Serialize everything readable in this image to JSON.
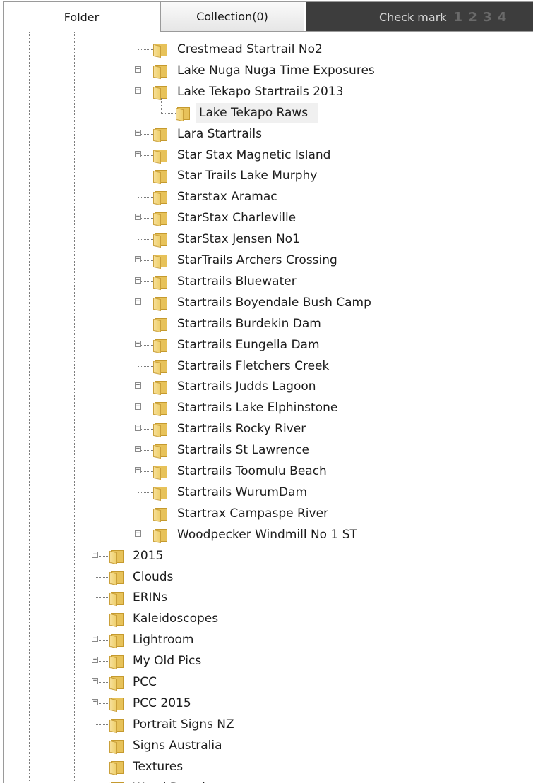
{
  "tabs": {
    "folder": "Folder",
    "collection": "Collection(0)",
    "check_mark": "Check mark",
    "check_digits": "1 2 3 4"
  },
  "tree": {
    "level3_items": [
      {
        "label": "Crestmead Startrail No2",
        "expandable": false
      },
      {
        "label": "Lake Nuga Nuga Time Exposures",
        "expandable": true
      },
      {
        "label": "Lake Tekapo Startrails 2013",
        "expandable": true,
        "expanded": true
      },
      {
        "label": "Lake Tekapo Raws",
        "expandable": false,
        "child": true,
        "selected": true
      },
      {
        "label": "Lara Startrails",
        "expandable": true
      },
      {
        "label": "Star Stax Magnetic Island",
        "expandable": true
      },
      {
        "label": "Star Trails Lake Murphy",
        "expandable": false
      },
      {
        "label": "Starstax Aramac",
        "expandable": false
      },
      {
        "label": "StarStax Charleville",
        "expandable": true
      },
      {
        "label": "StarStax Jensen No1",
        "expandable": false
      },
      {
        "label": "StarTrails Archers Crossing",
        "expandable": true
      },
      {
        "label": "Startrails Bluewater",
        "expandable": true
      },
      {
        "label": "Startrails Boyendale Bush Camp",
        "expandable": true
      },
      {
        "label": "Startrails Burdekin Dam",
        "expandable": false
      },
      {
        "label": "Startrails Eungella Dam",
        "expandable": true
      },
      {
        "label": "Startrails Fletchers Creek",
        "expandable": false
      },
      {
        "label": "Startrails Judds Lagoon",
        "expandable": true
      },
      {
        "label": "Startrails Lake Elphinstone",
        "expandable": true
      },
      {
        "label": "Startrails Rocky River",
        "expandable": true
      },
      {
        "label": "Startrails St Lawrence",
        "expandable": true
      },
      {
        "label": "Startrails Toomulu Beach",
        "expandable": true
      },
      {
        "label": "Startrails WurumDam",
        "expandable": false
      },
      {
        "label": "Startrax Campaspe River",
        "expandable": false
      },
      {
        "label": "Woodpecker Windmill No 1 ST",
        "expandable": true
      }
    ],
    "level2_items": [
      {
        "label": "2015",
        "expandable": true
      },
      {
        "label": "Clouds",
        "expandable": false
      },
      {
        "label": "ERINs",
        "expandable": false
      },
      {
        "label": "Kaleidoscopes",
        "expandable": false
      },
      {
        "label": "Lightroom",
        "expandable": true
      },
      {
        "label": "My Old Pics",
        "expandable": true
      },
      {
        "label": "PCC",
        "expandable": true
      },
      {
        "label": "PCC 2015",
        "expandable": true
      },
      {
        "label": "Portrait Signs NZ",
        "expandable": false
      },
      {
        "label": "Signs Australia",
        "expandable": false
      },
      {
        "label": "Textures",
        "expandable": false
      },
      {
        "label": "Wood Boards",
        "expandable": true
      }
    ],
    "expand_glyph": "+",
    "collapse_glyph": "−"
  },
  "colors": {
    "folder_yellow": "#e7c25a",
    "tab_dark": "#3d3d3d",
    "selected_bg": "#f0f0f0"
  },
  "icons": [
    "folder-icon",
    "expand-icon",
    "collapse-icon"
  ]
}
